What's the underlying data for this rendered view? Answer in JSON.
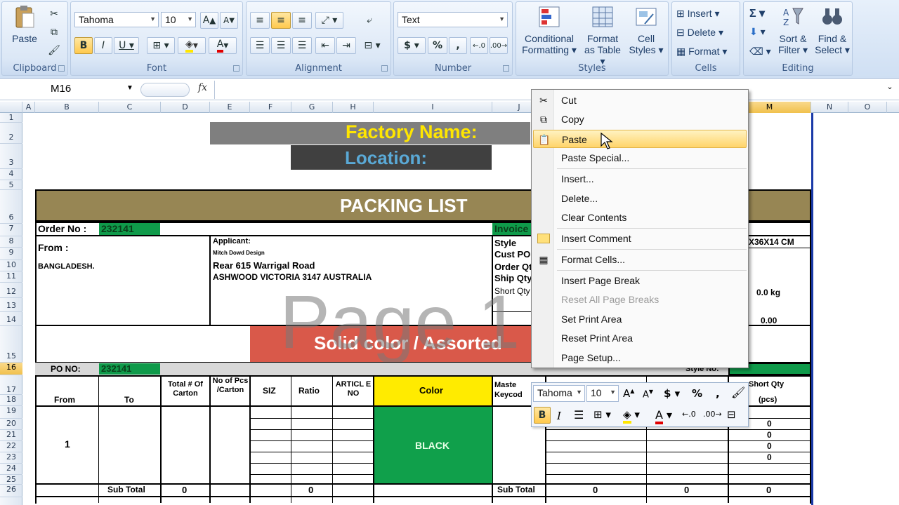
{
  "ribbon": {
    "clipboard": {
      "label": "Clipboard",
      "paste": "Paste"
    },
    "font": {
      "label": "Font",
      "name": "Tahoma",
      "size": "10"
    },
    "alignment": {
      "label": "Alignment"
    },
    "number": {
      "label": "Number",
      "format": "Text",
      "currency": "$",
      "percent": "%",
      "comma": ","
    },
    "styles": {
      "label": "Styles",
      "conditional": [
        "Conditional",
        "Formatting"
      ],
      "format_table": [
        "Format",
        "as Table"
      ],
      "cell_styles": [
        "Cell",
        "Styles"
      ]
    },
    "cells": {
      "label": "Cells",
      "insert": "Insert",
      "delete": "Delete",
      "format": "Format"
    },
    "editing": {
      "label": "Editing",
      "sigma": "Σ",
      "sort": [
        "Sort &",
        "Filter"
      ],
      "find": [
        "Find &",
        "Select"
      ]
    }
  },
  "formula_bar": {
    "name_box": "M16",
    "fx": "fx",
    "value": ""
  },
  "columns": [
    "A",
    "B",
    "C",
    "D",
    "E",
    "F",
    "G",
    "H",
    "I",
    "J",
    "M",
    "N",
    "O"
  ],
  "rows": [
    "1",
    "2",
    "3",
    "4",
    "5",
    "6",
    "7",
    "8",
    "9",
    "10",
    "11",
    "12",
    "13",
    "14",
    "15",
    "16",
    "17",
    "18",
    "19",
    "20",
    "21",
    "22",
    "23",
    "24",
    "25",
    "26"
  ],
  "sheet": {
    "factory_name": "Factory Name:",
    "location": "Location:",
    "title": "PACKING  LIST",
    "order_no_label": "Order No :",
    "order_no": "232141",
    "invoice_label": "Invoice",
    "from_label": "From :",
    "from_country": "BANGLADESH.",
    "applicant_label": "Applicant:",
    "applicant_name": "Mitch Dowd Design",
    "applicant_addr1": "Rear 615 Warrigal Road",
    "applicant_addr2": "ASHWOOD VICTORIA 3147 AUSTRALIA",
    "style_label": "Style",
    "cust_po_label": "Cust PO",
    "order_qty_label": "Order Qty",
    "ship_qty_label": "Ship Qty",
    "short_qty_label": "Short Qty",
    "carton_dim": "X36X14 CM",
    "weight": "0.0 kg",
    "value_000": "0.00",
    "page_watermark": "Page 1",
    "solid_banner": "Solid color / Assorted",
    "po_no_label": "PO NO:",
    "po_no": "232141",
    "style_no_label": "Style No:",
    "headers": {
      "from": "From",
      "to": "To",
      "total_carton": "Total # Of Carton",
      "pcs_carton": "No of Pcs /Carton",
      "size": "SIZ",
      "ratio": "Ratio",
      "article": "ARTICL E NO",
      "color": "Color",
      "master": "Maste Keycod",
      "short_qty": "Short Qty",
      "pcs": "(pcs)"
    },
    "row_no": "1",
    "color_value": "BLACK",
    "sub_total": "Sub Total",
    "zero": "0",
    "short_vals": [
      "0",
      "0",
      "0",
      "0"
    ]
  },
  "context_menu": {
    "items": [
      "Cut",
      "Copy",
      "Paste",
      "Paste Special...",
      "Insert...",
      "Delete...",
      "Clear Contents",
      "Insert Comment",
      "Format Cells...",
      "Insert Page Break",
      "Reset All Page Breaks",
      "Set Print Area",
      "Reset Print Area",
      "Page Setup..."
    ]
  },
  "mini_toolbar": {
    "font": "Tahoma",
    "size": "10",
    "currency": "$",
    "percent": "%",
    "comma": ","
  }
}
